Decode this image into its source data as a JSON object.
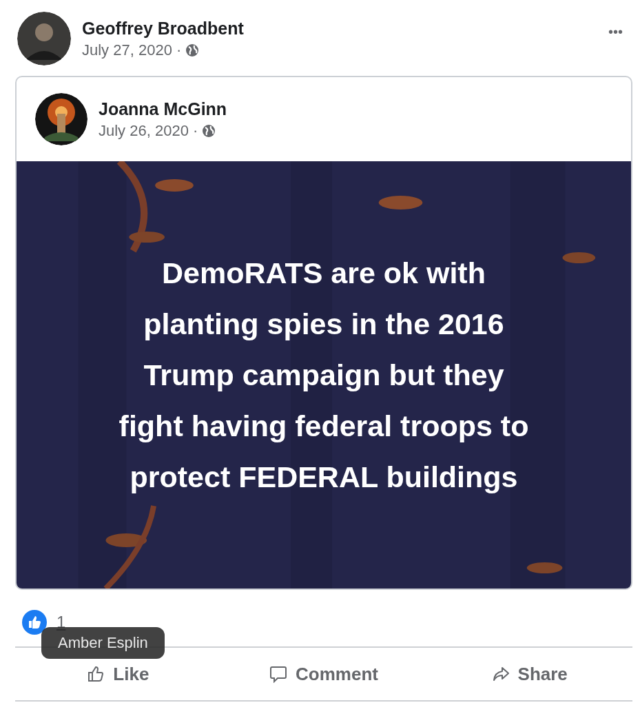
{
  "post": {
    "author": "Geoffrey Broadbent",
    "date": "July 27, 2020 ·",
    "more": "•••"
  },
  "shared": {
    "author": "Joanna McGinn",
    "date": "July 26, 2020 ·",
    "text_lines": [
      "DemoRATS are ok with",
      "planting spies in the 2016",
      "Trump campaign but they",
      "fight having federal troops to",
      "protect FEDERAL buildings"
    ]
  },
  "reactions": {
    "count": "1"
  },
  "tooltip": "Amber Esplin",
  "actions": [
    {
      "kind": "like",
      "label": "Like"
    },
    {
      "kind": "comment",
      "label": "Comment"
    },
    {
      "kind": "share",
      "label": "Share"
    }
  ]
}
